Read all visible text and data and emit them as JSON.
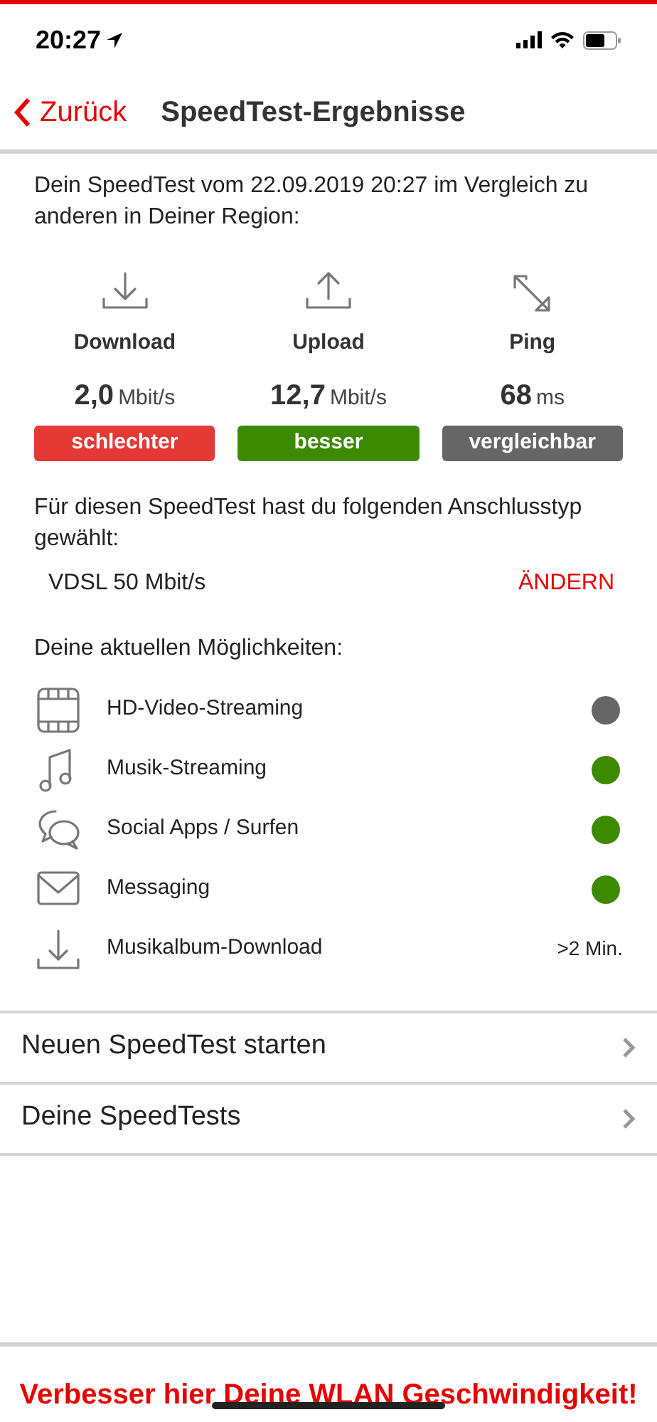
{
  "status_bar": {
    "time": "20:27"
  },
  "nav": {
    "back": "Zurück",
    "title": "SpeedTest-Ergebnisse"
  },
  "intro": "Dein SpeedTest vom 22.09.2019 20:27 im Vergleich zu anderen in Deiner Region:",
  "metrics": [
    {
      "kind": "download",
      "label": "Download",
      "value": "2,0",
      "unit": "Mbit/s",
      "rating": "schlechter",
      "color": "#e53935"
    },
    {
      "kind": "upload",
      "label": "Upload",
      "value": "12,7",
      "unit": "Mbit/s",
      "rating": "besser",
      "color": "#3d8a00"
    },
    {
      "kind": "ping",
      "label": "Ping",
      "value": "68",
      "unit": "ms",
      "rating": "vergleichbar",
      "color": "#666666"
    }
  ],
  "connection": {
    "text": "Für diesen SpeedTest hast du folgenden Anschlusstyp gewählt:",
    "type": "VDSL 50 Mbit/s",
    "change": "ÄNDERN"
  },
  "capabilities": {
    "title": "Deine aktuellen Möglichkeiten:",
    "items": [
      {
        "label": "HD-Video-Streaming",
        "kind": "dot",
        "color": "#666666"
      },
      {
        "label": "Musik-Streaming",
        "kind": "dot",
        "color": "#3d8a00"
      },
      {
        "label": "Social Apps / Surfen",
        "kind": "dot",
        "color": "#3d8a00"
      },
      {
        "label": "Messaging",
        "kind": "dot",
        "color": "#3d8a00"
      },
      {
        "label": "Musikalbum-Download",
        "kind": "text",
        "value": ">2 Min."
      }
    ]
  },
  "links": [
    "Neuen SpeedTest starten",
    "Deine SpeedTests"
  ],
  "footer": "Verbesser hier Deine WLAN Geschwindigkeit!"
}
